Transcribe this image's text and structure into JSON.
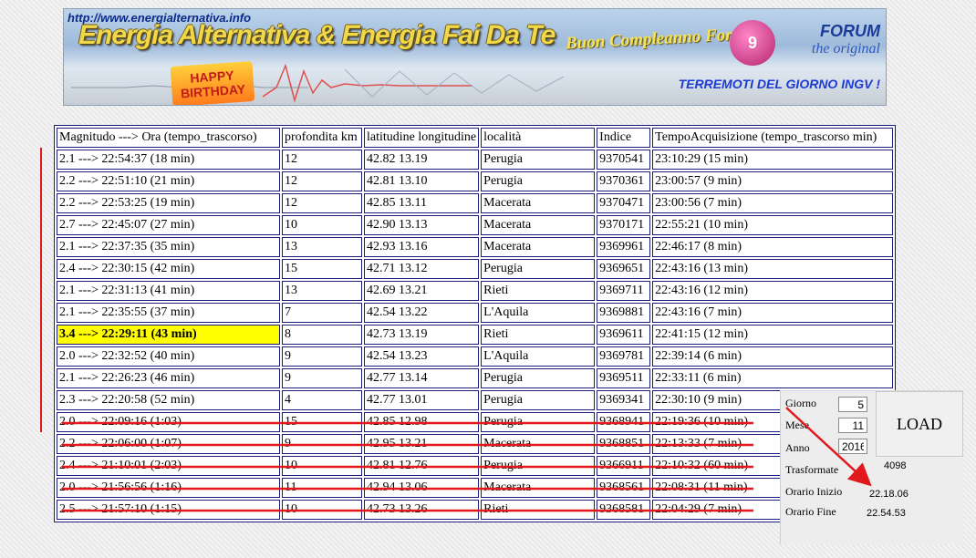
{
  "banner": {
    "url": "http://www.energialternativa.info",
    "title": "Energia Alternativa & Energia Fai Da Te",
    "birthday": "Buon Compleanno Forum",
    "forum_1": "FORUM",
    "forum_2": "the original",
    "subtitle": "TERREMOTI DEL GIORNO INGV !",
    "happy_1": "HAPPY",
    "happy_2": "BIRTHDAY",
    "cake": "9"
  },
  "table": {
    "headers": [
      "Magnitudo ---> Ora (tempo_trascorso)",
      "profondita km",
      "latitudine longitudine",
      "località",
      "Indice",
      "TempoAcquisizione (tempo_trascorso min)"
    ],
    "rows": [
      {
        "mag": "2.1 ---> 22:54:37 (18 min)",
        "depth": "12",
        "latlon": "42.82 13.19",
        "loc": "Perugia",
        "idx": "9370541",
        "acq": "23:10:29 (15 min)",
        "highlight": false,
        "struck": false
      },
      {
        "mag": "2.2 ---> 22:51:10 (21 min)",
        "depth": "12",
        "latlon": "42.81 13.10",
        "loc": "Perugia",
        "idx": "9370361",
        "acq": "23:00:57 (9 min)",
        "highlight": false,
        "struck": false
      },
      {
        "mag": "2.2 ---> 22:53:25 (19 min)",
        "depth": "12",
        "latlon": "42.85 13.11",
        "loc": "Macerata",
        "idx": "9370471",
        "acq": "23:00:56 (7 min)",
        "highlight": false,
        "struck": false
      },
      {
        "mag": "2.7 ---> 22:45:07 (27 min)",
        "depth": "10",
        "latlon": "42.90 13.13",
        "loc": "Macerata",
        "idx": "9370171",
        "acq": "22:55:21 (10 min)",
        "highlight": false,
        "struck": false
      },
      {
        "mag": "2.1 ---> 22:37:35 (35 min)",
        "depth": "13",
        "latlon": "42.93 13.16",
        "loc": "Macerata",
        "idx": "9369961",
        "acq": "22:46:17 (8 min)",
        "highlight": false,
        "struck": false
      },
      {
        "mag": "2.4 ---> 22:30:15 (42 min)",
        "depth": "15",
        "latlon": "42.71 13.12",
        "loc": "Perugia",
        "idx": "9369651",
        "acq": "22:43:16 (13 min)",
        "highlight": false,
        "struck": false
      },
      {
        "mag": "2.1 ---> 22:31:13 (41 min)",
        "depth": "13",
        "latlon": "42.69 13.21",
        "loc": "Rieti",
        "idx": "9369711",
        "acq": "22:43:16 (12 min)",
        "highlight": false,
        "struck": false
      },
      {
        "mag": "2.1 ---> 22:35:55 (37 min)",
        "depth": "7",
        "latlon": "42.54 13.22",
        "loc": "L'Aquila",
        "idx": "9369881",
        "acq": "22:43:16 (7 min)",
        "highlight": false,
        "struck": false
      },
      {
        "mag": "3.4 ---> 22:29:11 (43 min)",
        "depth": "8",
        "latlon": "42.73 13.19",
        "loc": "Rieti",
        "idx": "9369611",
        "acq": "22:41:15 (12 min)",
        "highlight": true,
        "struck": false
      },
      {
        "mag": "2.0 ---> 22:32:52 (40 min)",
        "depth": "9",
        "latlon": "42.54 13.23",
        "loc": "L'Aquila",
        "idx": "9369781",
        "acq": "22:39:14 (6 min)",
        "highlight": false,
        "struck": false
      },
      {
        "mag": "2.1 ---> 22:26:23 (46 min)",
        "depth": "9",
        "latlon": "42.77 13.14",
        "loc": "Perugia",
        "idx": "9369511",
        "acq": "22:33:11 (6 min)",
        "highlight": false,
        "struck": false
      },
      {
        "mag": "2.3 ---> 22:20:58 (52 min)",
        "depth": "4",
        "latlon": "42.77 13.01",
        "loc": "Perugia",
        "idx": "9369341",
        "acq": "22:30:10 (9 min)",
        "highlight": false,
        "struck": false
      },
      {
        "mag": "2.0 ---> 22:09:16 (1:03)",
        "depth": "15",
        "latlon": "42.85 12.98",
        "loc": "Perugia",
        "idx": "9368941",
        "acq": "22:19:36 (10 min)",
        "highlight": false,
        "struck": true
      },
      {
        "mag": "2.2 ---> 22:06:00 (1:07)",
        "depth": "9",
        "latlon": "42.95 13.21",
        "loc": "Macerata",
        "idx": "9368851",
        "acq": "22:13:33 (7 min)",
        "highlight": false,
        "struck": true
      },
      {
        "mag": "2.4 ---> 21:10:01 (2:03)",
        "depth": "10",
        "latlon": "42.81 12.76",
        "loc": "Perugia",
        "idx": "9366911",
        "acq": "22:10:32 (60 min)",
        "highlight": false,
        "struck": true
      },
      {
        "mag": "2.0 ---> 21:56:56 (1:16)",
        "depth": "11",
        "latlon": "42.94 13.06",
        "loc": "Macerata",
        "idx": "9368561",
        "acq": "22:08:31 (11 min)",
        "highlight": false,
        "struck": true
      },
      {
        "mag": "2.5 ---> 21:57:10 (1:15)",
        "depth": "10",
        "latlon": "42.73 13.26",
        "loc": "Rieti",
        "idx": "9368581",
        "acq": "22:04:29 (7 min)",
        "highlight": false,
        "struck": true
      }
    ]
  },
  "panel": {
    "giorno_label": "Giorno",
    "giorno_value": "5",
    "mese_label": "Mese",
    "mese_value": "11",
    "anno_label": "Anno",
    "anno_value": "2016",
    "load_label": "LOAD",
    "trasformate_label": "Trasformate",
    "trasformate_value": "4098",
    "inizio_label": "Orario Inizio",
    "inizio_value": "22.18.06",
    "fine_label": "Orario Fine",
    "fine_value": "22.54.53"
  },
  "colors": {
    "annotation_red": "#e1191c",
    "highlight_yellow": "#ffff00",
    "table_border": "#1b1b7e"
  }
}
